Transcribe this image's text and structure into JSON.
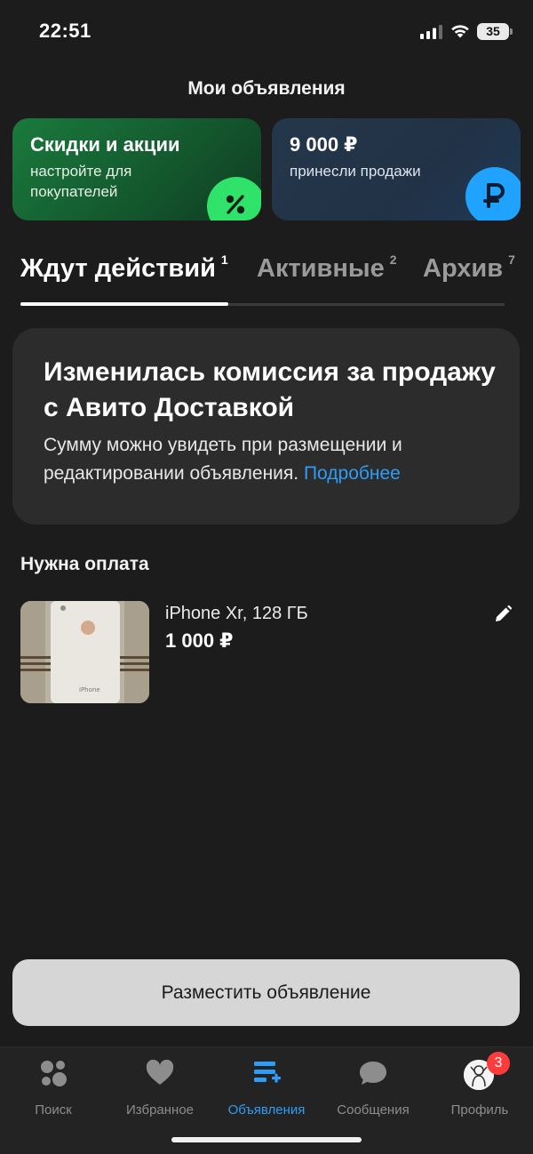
{
  "status_bar": {
    "time": "22:51",
    "battery": "35"
  },
  "header": {
    "title": "Мои объявления"
  },
  "promo_cards": [
    {
      "title": "Скидки и акции",
      "subtitle": "настройте для покупателей",
      "icon": "percent-icon",
      "accent": "#2ee26a"
    },
    {
      "title": "9 000 ₽",
      "subtitle": "принесли продажи",
      "icon": "ruble-icon",
      "accent": "#1fa3ff"
    }
  ],
  "tabs": [
    {
      "label": "Ждут действий",
      "count": "1",
      "active": true
    },
    {
      "label": "Активные",
      "count": "2",
      "active": false
    },
    {
      "label": "Архив",
      "count": "7",
      "active": false
    }
  ],
  "banner": {
    "title": "Изменилась комиссия за продажу с Авито Доставкой",
    "text": "Сумму можно увидеть при размещении и редактировании объявления.",
    "link": "Подробнее"
  },
  "section": {
    "title": "Нужна оплата"
  },
  "listings": [
    {
      "title": "iPhone Xr, 128 ГБ",
      "price": "1 000 ₽",
      "thumb_label": "iPhone"
    }
  ],
  "post_button": {
    "label": "Разместить объявление"
  },
  "bottom_nav": [
    {
      "label": "Поиск",
      "icon": "search-bubbles-icon",
      "active": false
    },
    {
      "label": "Избранное",
      "icon": "heart-icon",
      "active": false
    },
    {
      "label": "Объявления",
      "icon": "listings-add-icon",
      "active": true
    },
    {
      "label": "Сообщения",
      "icon": "chat-bubble-icon",
      "active": false
    },
    {
      "label": "Профиль",
      "icon": "avatar",
      "badge": "3",
      "active": false
    }
  ],
  "colors": {
    "accent_blue": "#2f9cf5",
    "background": "#1c1c1c",
    "badge_red": "#ff3b3b"
  }
}
